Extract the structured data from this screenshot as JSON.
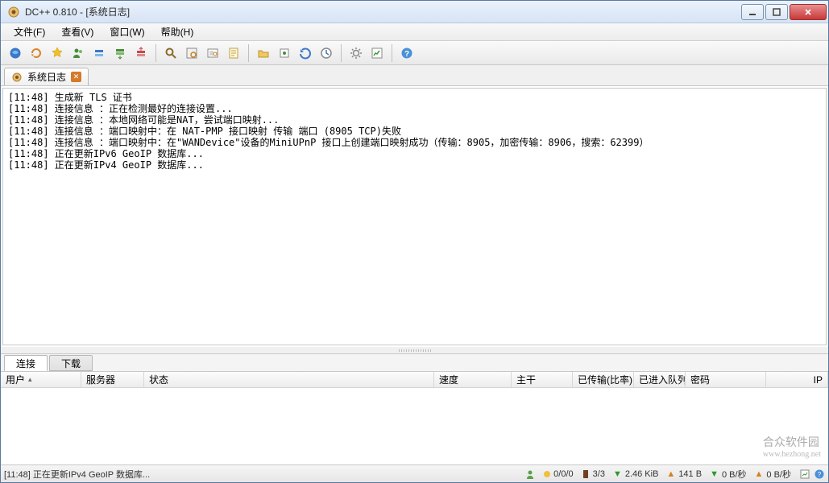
{
  "title": "DC++ 0.810 - [系统日志]",
  "menu": {
    "file": "文件(F)",
    "view": "查看(V)",
    "window": "窗口(W)",
    "help": "帮助(H)"
  },
  "toolbar_icons": [
    "home-icon",
    "reconnect-icon",
    "favorites-icon",
    "users-icon",
    "queue-icon",
    "finished-dl-icon",
    "finished-ul-icon",
    "search-icon",
    "adl-search-icon",
    "spy-icon",
    "notepad-icon",
    "open-list-icon",
    "own-list-icon",
    "refresh-icon",
    "recent-icon",
    "settings-icon",
    "stats-icon",
    "help-icon"
  ],
  "tab": {
    "label": "系统日志"
  },
  "log": [
    "[11:48] 生成新 TLS 证书",
    "[11:48] 连接信息 ：正在检测最好的连接设置...",
    "[11:48] 连接信息 ：本地网络可能是NAT，尝试端口映射...",
    "[11:48] 连接信息 ：端口映射中：在 NAT-PMP 接口映射 传输 端口 (8905 TCP)失败",
    "[11:48] 连接信息 ：端口映射中：在\"WANDevice\"设备的MiniUPnP 接口上创建端口映射成功（传输：8905，加密传输：8906，搜索：62399）",
    "[11:48] 正在更新IPv6 GeoIP 数据库...",
    "[11:48] 正在更新IPv4 GeoIP 数据库..."
  ],
  "bottom": {
    "tabs": {
      "connections": "连接",
      "downloads": "下载"
    },
    "columns": {
      "user": "用户",
      "server": "服务器",
      "status": "状态",
      "speed": "速度",
      "trunk": "主干",
      "transferred": "已传输(比率)",
      "queued": "已进入队列",
      "cipher": "密码",
      "ip": "IP"
    }
  },
  "status": {
    "main": "[11:48] 正在更新IPv4 GeoIP 数据库...",
    "slots": "0/0/0",
    "hubs": "3/3",
    "down": "2.46 KiB",
    "up": "141 B",
    "downspeed": "0 B/秒",
    "upspeed": "0 B/秒"
  },
  "watermark": "合众软件园",
  "watermark_url": "www.hezhong.net"
}
